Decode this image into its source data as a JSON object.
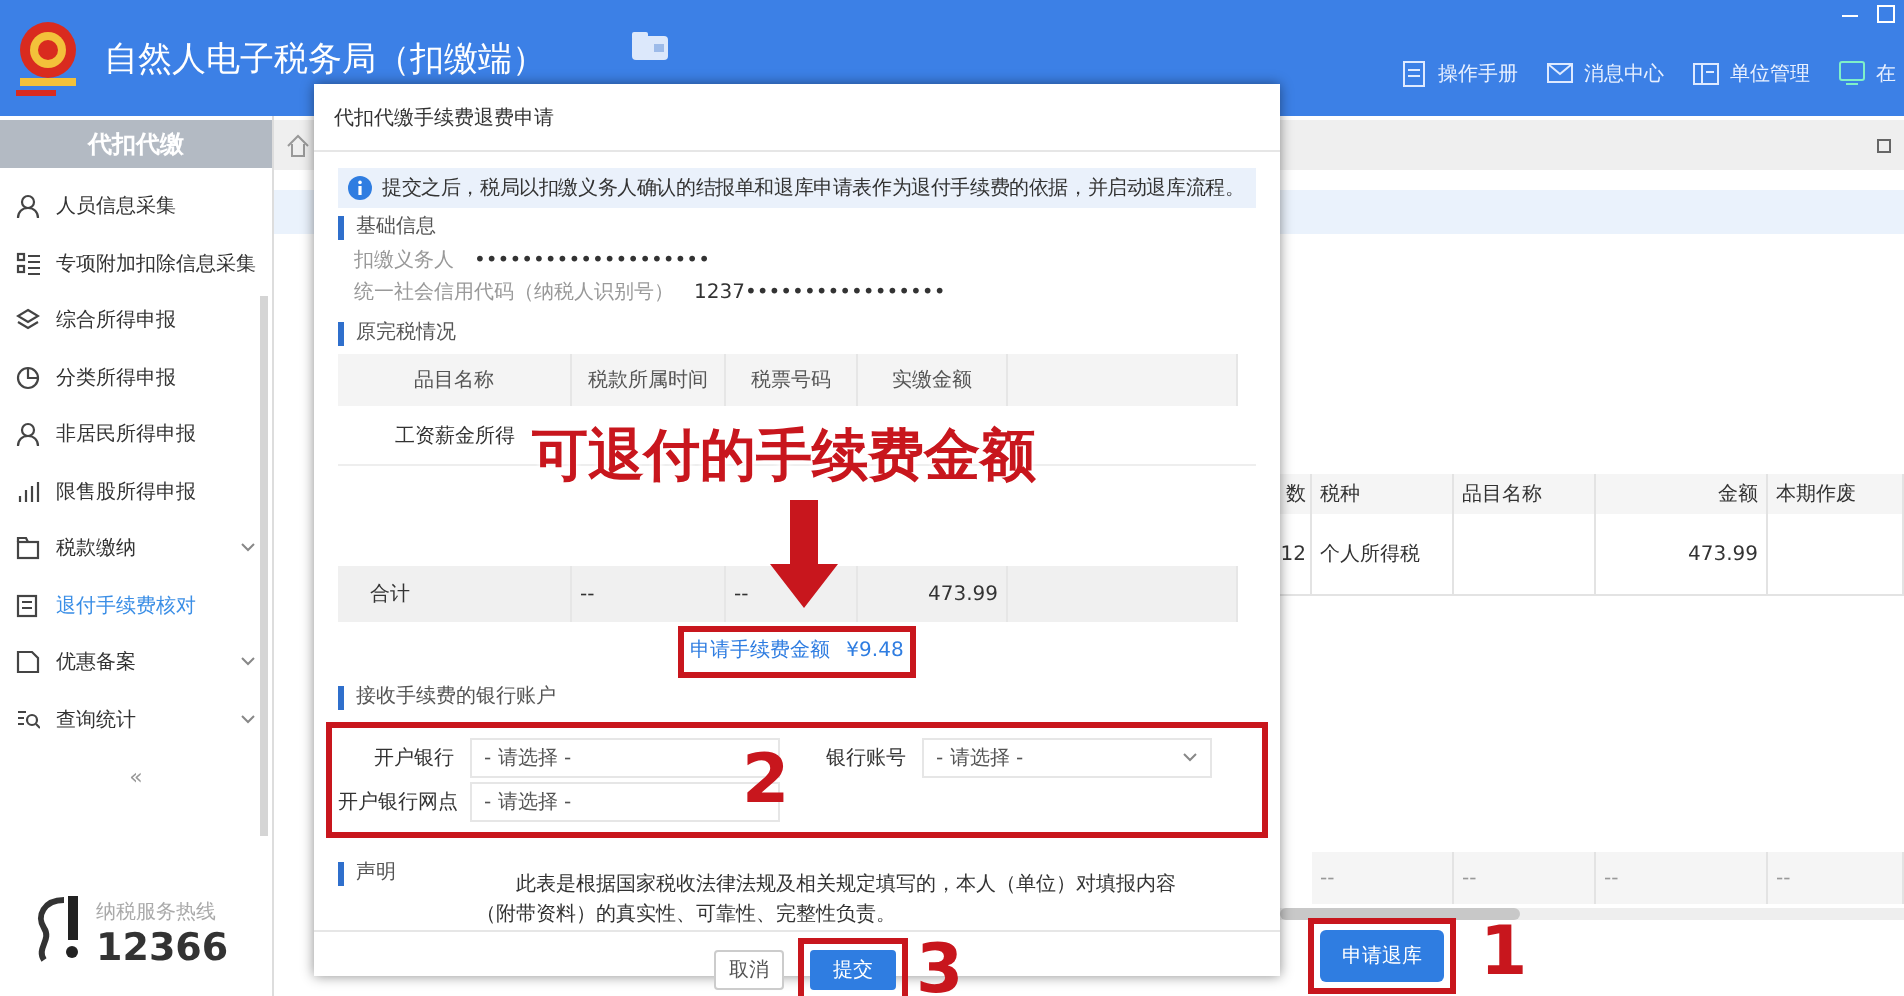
{
  "header": {
    "title": "自然人电子税务局（扣缴端）",
    "nav": [
      {
        "label": "操作手册"
      },
      {
        "label": "消息中心"
      },
      {
        "label": "单位管理"
      },
      {
        "label": "在"
      }
    ]
  },
  "sidebar": {
    "heading": "代扣代缴",
    "items": [
      {
        "label": "人员信息采集",
        "selected": false,
        "expandable": false
      },
      {
        "label": "专项附加扣除信息采集",
        "selected": false,
        "expandable": false
      },
      {
        "label": "综合所得申报",
        "selected": false,
        "expandable": false
      },
      {
        "label": "分类所得申报",
        "selected": false,
        "expandable": false
      },
      {
        "label": "非居民所得申报",
        "selected": false,
        "expandable": false
      },
      {
        "label": "限售股所得申报",
        "selected": false,
        "expandable": false
      },
      {
        "label": "税款缴纳",
        "selected": false,
        "expandable": true
      },
      {
        "label": "退付手续费核对",
        "selected": true,
        "expandable": false
      },
      {
        "label": "优惠备案",
        "selected": false,
        "expandable": true
      },
      {
        "label": "查询统计",
        "selected": false,
        "expandable": true
      }
    ],
    "collapse": "«",
    "hotline": {
      "label": "纳税服务热线",
      "number": "12366"
    }
  },
  "main": {
    "table": {
      "columns": [
        "数",
        "税种",
        "品目名称",
        "金额",
        "本期作废"
      ],
      "rows": [
        [
          "12",
          "个人所得税",
          null,
          "473.99",
          null
        ]
      ],
      "footer": [
        "--",
        "--",
        "--",
        "--"
      ]
    },
    "button": {
      "label": "申请退库",
      "highlighted": true,
      "callout": "1"
    }
  },
  "dialog": {
    "title": "代扣代缴手续费退费申请",
    "notice": "提交之后，税局以扣缴义务人确认的结报单和退库申请表作为退付手续费的依据，并启动退库流程。",
    "basic": {
      "heading": "基础信息",
      "fields": [
        {
          "label": "扣缴义务人",
          "value": "••••••••••••••••••••"
        },
        {
          "label": "统一社会信用代码（纳税人识别号）",
          "value": "1237•••••••••••••••••"
        }
      ]
    },
    "tax": {
      "heading": "原完税情况",
      "columns": [
        "品目名称",
        "税款所属时间",
        "税票号码",
        "实缴金额"
      ],
      "rows": [
        [
          "工资薪金所得"
        ]
      ],
      "total": [
        "合计",
        "--",
        "--",
        "473.99"
      ]
    },
    "fee": {
      "label": "申请手续费金额",
      "value": "¥9.48",
      "highlighted": true
    },
    "bank": {
      "heading": "接收手续费的银行账户",
      "highlighted": true,
      "callout": "2",
      "fields": [
        {
          "label": "开户银行",
          "placeholder": "- 请选择 -",
          "kind": "picker"
        },
        {
          "label": "银行账号",
          "placeholder": "- 请选择 -",
          "kind": "select"
        },
        {
          "label": "开户银行网点",
          "placeholder": "- 请选择 -",
          "kind": "picker"
        }
      ]
    },
    "statement": {
      "heading": "声明",
      "text": "此表是根据国家税收法律法规及相关规定填写的，本人（单位）对填报内容（附带资料）的真实性、可靠性、完整性负责。"
    },
    "buttons": [
      {
        "label": "取消",
        "kind": "secondary",
        "highlighted": false
      },
      {
        "label": "提交",
        "kind": "primary",
        "highlighted": true,
        "callout": "3"
      }
    ]
  },
  "annotation": {
    "text": "可退付的手续费金额"
  }
}
